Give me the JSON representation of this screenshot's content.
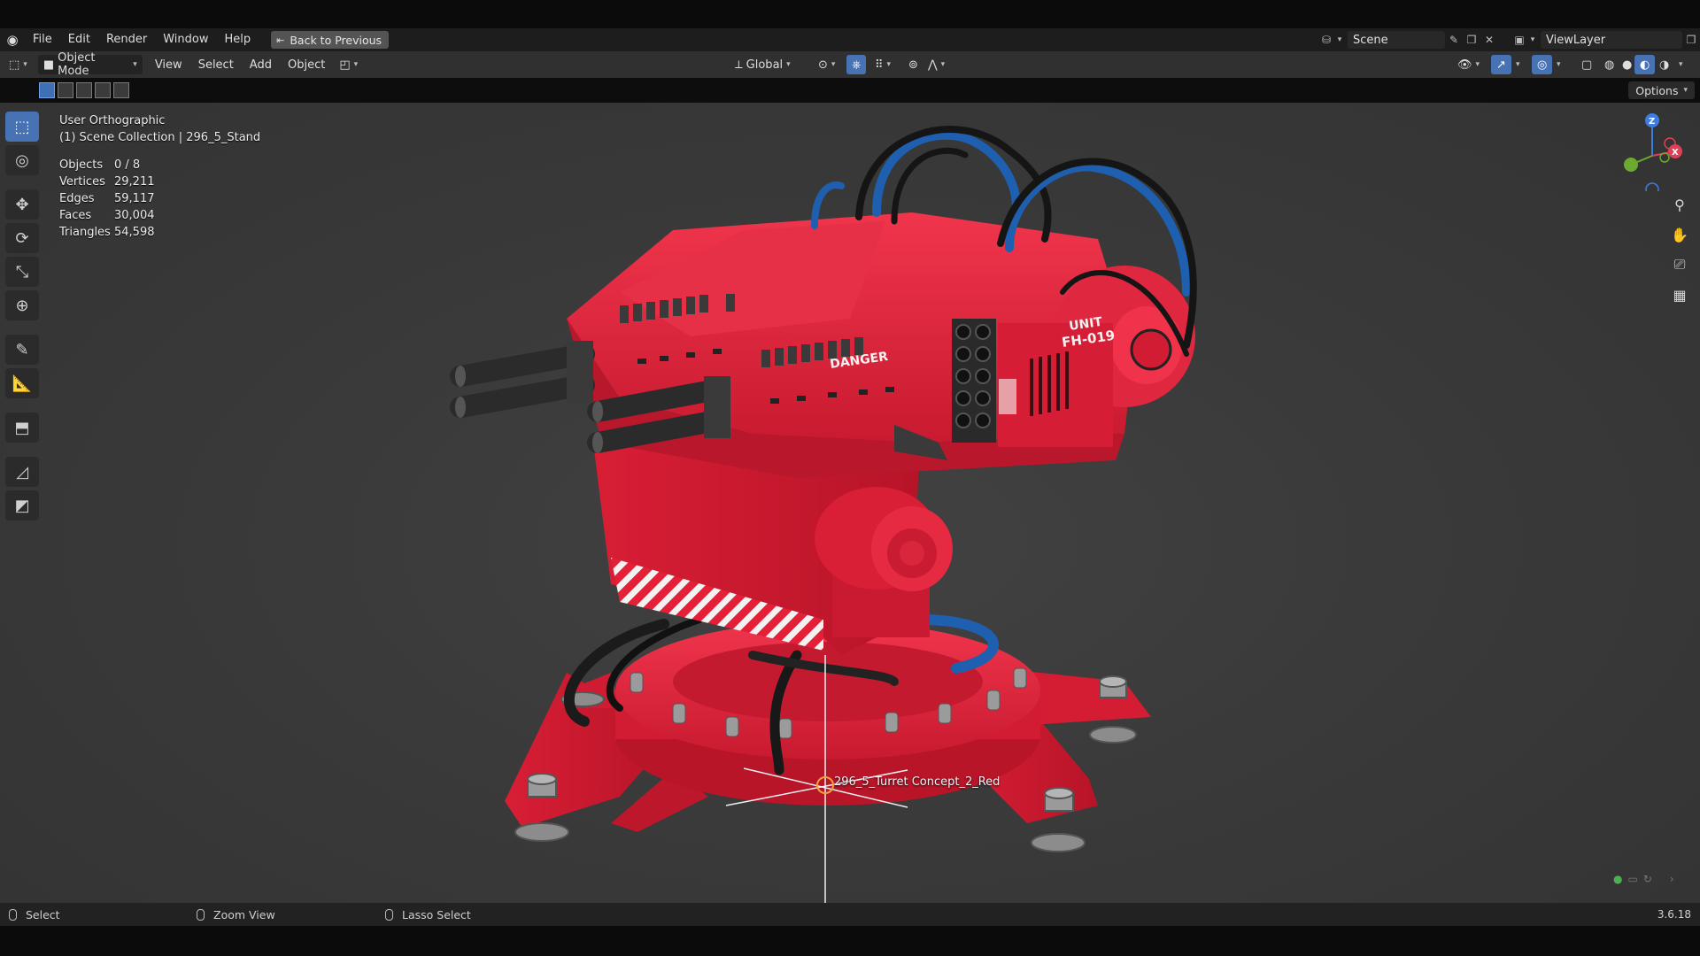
{
  "menubar": {
    "items": [
      "File",
      "Edit",
      "Render",
      "Window",
      "Help"
    ],
    "back_button": "Back to Previous",
    "scene_name": "Scene",
    "view_layer_name": "ViewLayer"
  },
  "header": {
    "mode": "Object Mode",
    "menus": [
      "View",
      "Select",
      "Add",
      "Object"
    ],
    "transform_orientation": "Global",
    "options_label": "Options"
  },
  "viewport": {
    "view_name": "User Orthographic",
    "collection_info": "(1) Scene Collection | 296_5_Stand",
    "stats": [
      {
        "label": "Objects",
        "value": "0 / 8"
      },
      {
        "label": "Vertices",
        "value": "29,211"
      },
      {
        "label": "Edges",
        "value": "59,117"
      },
      {
        "label": "Faces",
        "value": "30,004"
      },
      {
        "label": "Triangles",
        "value": "54,598"
      }
    ],
    "object_label": "296_5_Turret Concept_2_Red",
    "decal_unit": "UNIT",
    "decal_code": "FH-019",
    "decal_danger": "DANGER",
    "gizmo_axes": {
      "z": "Z",
      "x": "X"
    }
  },
  "statusbar": {
    "left_action": "Select",
    "middle_action": "Zoom View",
    "right_action": "Lasso Select",
    "version": "3.6.18"
  },
  "colors": {
    "accent": "#4772b3",
    "turret_red": "#e8203a",
    "cable_blue": "#1f5fb0"
  }
}
